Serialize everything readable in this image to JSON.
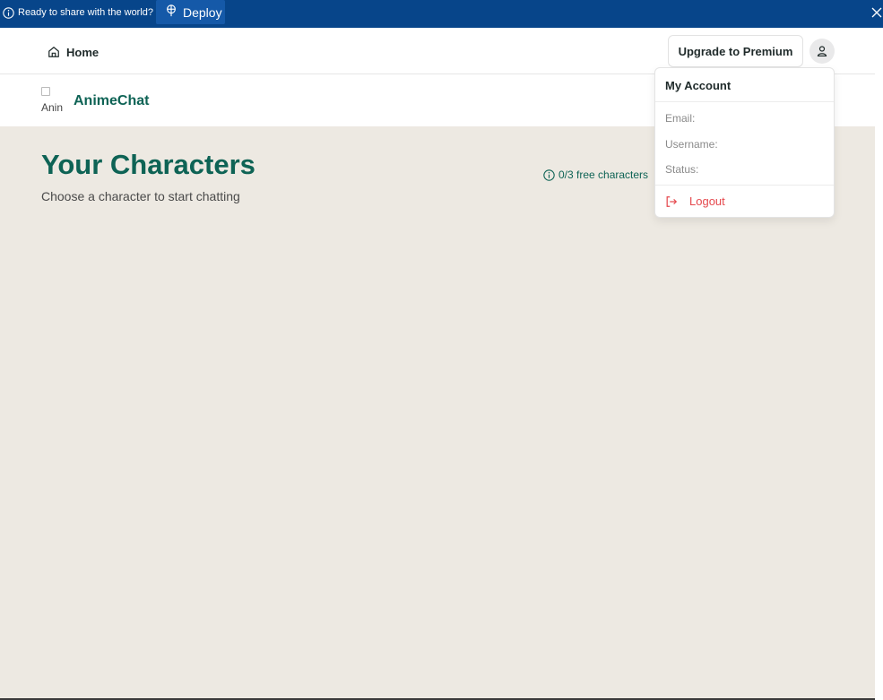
{
  "banner": {
    "ready_text": "Ready to share with the world?",
    "deploy_label": "Deploy"
  },
  "nav": {
    "home_label": "Home",
    "upgrade_label": "Upgrade to Premium"
  },
  "brand": {
    "logo_alt": "Anin",
    "name": "AnimeChat"
  },
  "main": {
    "title": "Your Characters",
    "subtitle": "Choose a character to start chatting",
    "quota": "0/3 free characters"
  },
  "account_menu": {
    "title": "My Account",
    "email_label": "Email:",
    "username_label": "Username:",
    "status_label": "Status:",
    "logout_label": "Logout"
  },
  "colors": {
    "banner_bg": "#07458a",
    "brand_green": "#0e6355",
    "page_bg": "#ede9e2",
    "logout_red": "#e5484d"
  },
  "icons": [
    "info-icon",
    "deploy-icon",
    "close-icon",
    "home-icon",
    "user-icon",
    "logout-icon"
  ]
}
